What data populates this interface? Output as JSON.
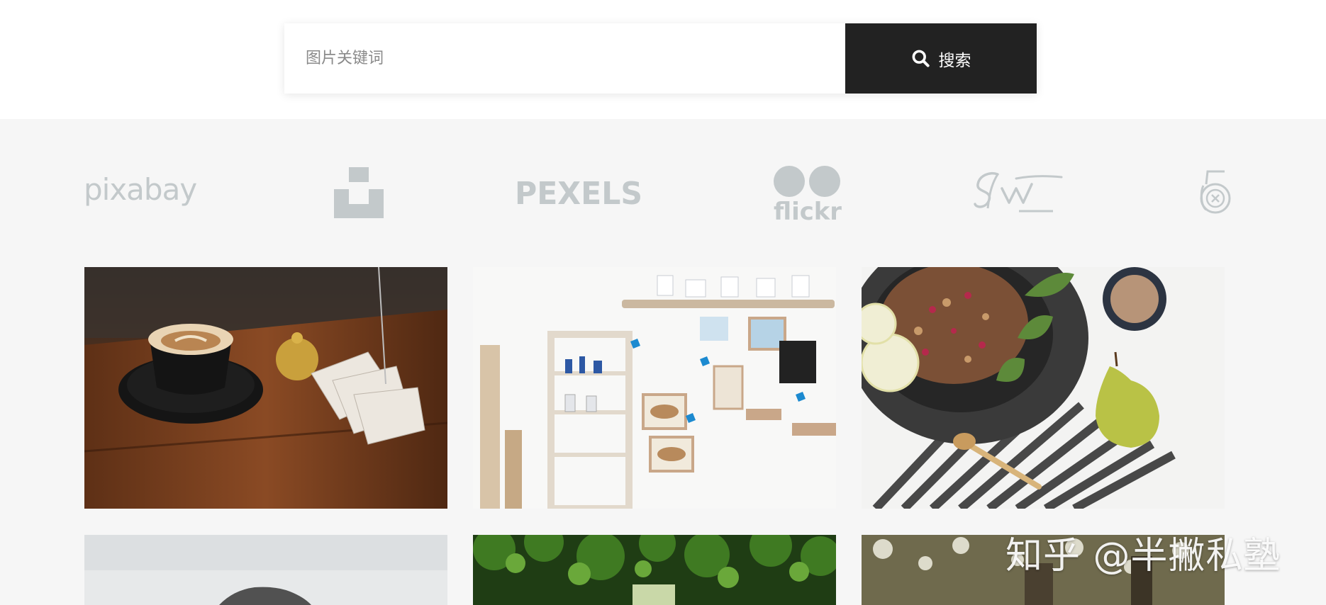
{
  "search": {
    "placeholder": "图片关键词",
    "button_label": "搜索",
    "button_color": "#222222"
  },
  "sources": [
    {
      "name": "pixabay",
      "icon": "pixabay-logo"
    },
    {
      "name": "",
      "icon": "unsplash-logo"
    },
    {
      "name": "PEXELS",
      "icon": "pexels-logo"
    },
    {
      "name": "flickr",
      "icon": "flickr-logo"
    },
    {
      "name": "",
      "icon": "stocksnap-logo"
    },
    {
      "name": "",
      "icon": "500px-logo"
    }
  ],
  "photos": [
    {
      "icon": "latte-coffee-photo"
    },
    {
      "icon": "driftwood-shelf-decor-photo"
    },
    {
      "icon": "granola-pear-breakfast-photo"
    },
    {
      "icon": "knit-beanie-person-photo"
    },
    {
      "icon": "forest-canopy-path-photo"
    },
    {
      "icon": "bokeh-woodland-photo"
    }
  ],
  "watermark": "知乎 @半撇私塾",
  "colors": {
    "logo_gray": "#c3c9cb",
    "page_bg": "#f6f6f6",
    "header_bg": "#ffffff"
  }
}
